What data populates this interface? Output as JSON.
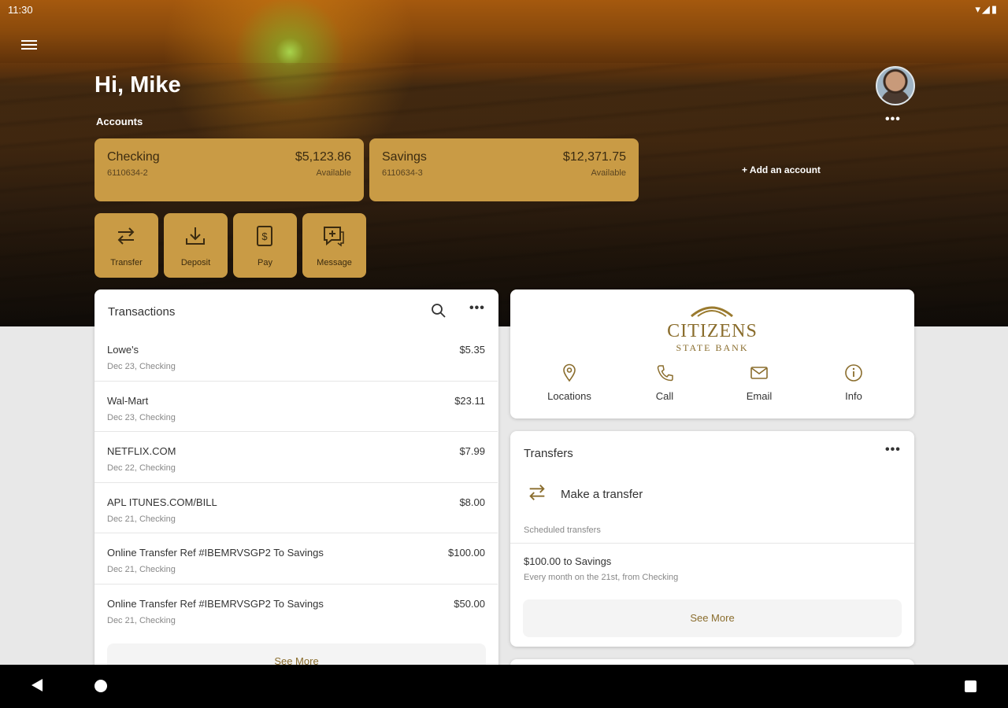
{
  "status_bar": {
    "time": "11:30",
    "icons": "▾◢▮"
  },
  "greeting": "Hi, Mike",
  "accounts": {
    "label": "Accounts",
    "more": "•••",
    "items": [
      {
        "name": "Checking",
        "number": "6110634-2",
        "balance": "$5,123.86",
        "balance_label": "Available"
      },
      {
        "name": "Savings",
        "number": "6110634-3",
        "balance": "$12,371.75",
        "balance_label": "Available"
      }
    ],
    "add_label": "+ Add an account"
  },
  "quick_actions": [
    {
      "label": "Transfer",
      "icon": "transfer-icon"
    },
    {
      "label": "Deposit",
      "icon": "download-icon"
    },
    {
      "label": "Pay",
      "icon": "dollar-bill-icon"
    },
    {
      "label": "Message",
      "icon": "message-icon"
    }
  ],
  "transactions": {
    "title": "Transactions",
    "more": "•••",
    "items": [
      {
        "description": "Lowe's",
        "detail": "Dec 23, Checking",
        "amount": "$5.35"
      },
      {
        "description": "Wal-Mart",
        "detail": "Dec 23, Checking",
        "amount": "$23.11"
      },
      {
        "description": "NETFLIX.COM",
        "detail": "Dec 22, Checking",
        "amount": "$7.99"
      },
      {
        "description": "APL ITUNES.COM/BILL",
        "detail": "Dec 21, Checking",
        "amount": "$8.00"
      },
      {
        "description": "Online Transfer Ref #IBEMRVSGP2 To Savings",
        "detail": "Dec 21, Checking",
        "amount": "$100.00"
      },
      {
        "description": "Online Transfer Ref #IBEMRVSGP2 To Savings",
        "detail": "Dec 21, Checking",
        "amount": "$50.00"
      }
    ],
    "see_more": "See More"
  },
  "bank": {
    "logo_line1": "CITIZENS",
    "logo_line2": "STATE BANK",
    "contacts": [
      {
        "label": "Locations",
        "icon": "location-pin-icon"
      },
      {
        "label": "Call",
        "icon": "phone-icon"
      },
      {
        "label": "Email",
        "icon": "email-icon"
      },
      {
        "label": "Info",
        "icon": "info-icon"
      }
    ]
  },
  "transfers": {
    "title": "Transfers",
    "more": "•••",
    "make_transfer": "Make a transfer",
    "scheduled_label": "Scheduled transfers",
    "scheduled": [
      {
        "title": "$100.00 to Savings",
        "detail": "Every month on the 21st, from Checking"
      }
    ],
    "see_more": "See More"
  },
  "colors": {
    "accent": "#c99b45",
    "accent_text": "#8a6d2d"
  }
}
